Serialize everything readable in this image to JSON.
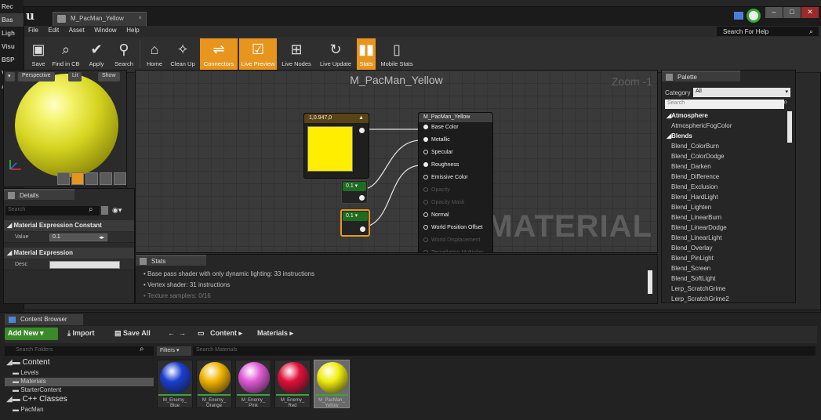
{
  "left_strip": [
    "Rec",
    "Bas",
    "Ligh",
    "Visu",
    "BSP",
    "Volu",
    "All C"
  ],
  "window": {
    "tab_title": "M_PacMan_Yellow",
    "tab_close": "×",
    "win_buttons": [
      "–",
      "□",
      "✕"
    ]
  },
  "menu": [
    "File",
    "Edit",
    "Asset",
    "Window",
    "Help"
  ],
  "search_help": {
    "placeholder": "Search For Help"
  },
  "toolbar": [
    {
      "label": "Save",
      "icon": "save-icon",
      "active": false
    },
    {
      "label": "Find in CB",
      "icon": "find-in-cb-icon",
      "active": false
    },
    {
      "label": "Apply",
      "icon": "apply-icon",
      "active": false
    },
    {
      "label": "Search",
      "icon": "search-icon",
      "active": false
    },
    {
      "label": "Home",
      "icon": "home-icon",
      "active": false
    },
    {
      "label": "Clean Up",
      "icon": "clean-up-icon",
      "active": false
    },
    {
      "label": "Connectors",
      "icon": "connectors-icon",
      "active": true
    },
    {
      "label": "Live Preview",
      "icon": "live-preview-icon",
      "active": true
    },
    {
      "label": "Live Nodes",
      "icon": "live-nodes-icon",
      "active": false
    },
    {
      "label": "Live Update",
      "icon": "live-update-icon",
      "active": false
    },
    {
      "label": "Stats",
      "icon": "stats-icon",
      "active": true
    },
    {
      "label": "Mobile Stats",
      "icon": "mobile-stats-icon",
      "active": false
    }
  ],
  "viewport": {
    "buttons": [
      "Perspective",
      "Lit",
      "Show"
    ]
  },
  "details": {
    "tab": "Details",
    "search_placeholder": "Search",
    "cat1": "Material Expression Constant",
    "value_label": "Value",
    "value": "0.1",
    "cat2": "Material Expression",
    "desc_label": "Desc"
  },
  "graph": {
    "title": "M_PacMan_Yellow",
    "zoom": "Zoom -1",
    "watermark": "MATERIAL",
    "color_node_header": "1,0.947,0",
    "const1": "0.1",
    "const2": "0.1",
    "result_header": "M_PacMan_Yellow",
    "inputs": [
      {
        "label": "Base Color",
        "filled": true,
        "dim": false
      },
      {
        "label": "Metallic",
        "filled": true,
        "dim": false
      },
      {
        "label": "Specular",
        "filled": false,
        "dim": false
      },
      {
        "label": "Roughness",
        "filled": true,
        "dim": false
      },
      {
        "label": "Emissive Color",
        "filled": false,
        "dim": false
      },
      {
        "label": "Opacity",
        "filled": false,
        "dim": true
      },
      {
        "label": "Opacity Mask",
        "filled": false,
        "dim": true
      },
      {
        "label": "Normal",
        "filled": false,
        "dim": false
      },
      {
        "label": "World Position Offset",
        "filled": false,
        "dim": false
      },
      {
        "label": "World Displacement",
        "filled": false,
        "dim": true
      },
      {
        "label": "Tessellation Multiplier",
        "filled": false,
        "dim": true
      }
    ]
  },
  "stats": {
    "tab": "Stats",
    "lines": [
      "Base pass shader with only dynamic lighting: 33 instructions",
      "Vertex shader: 31 instructions",
      "Texture samplers: 0/16"
    ]
  },
  "palette": {
    "tab": "Palette",
    "category_label": "Category",
    "category_value": "All",
    "search_placeholder": "Search",
    "items": [
      {
        "t": "Atmosphere",
        "grp": true
      },
      {
        "t": "AtmosphericFogColor",
        "grp": false
      },
      {
        "t": "Blends",
        "grp": true
      },
      {
        "t": "Blend_ColorBurn",
        "grp": false
      },
      {
        "t": "Blend_ColorDodge",
        "grp": false
      },
      {
        "t": "Blend_Darken",
        "grp": false
      },
      {
        "t": "Blend_Difference",
        "grp": false
      },
      {
        "t": "Blend_Exclusion",
        "grp": false
      },
      {
        "t": "Blend_HardLight",
        "grp": false
      },
      {
        "t": "Blend_Lighten",
        "grp": false
      },
      {
        "t": "Blend_LinearBurn",
        "grp": false
      },
      {
        "t": "Blend_LinearDodge",
        "grp": false
      },
      {
        "t": "Blend_LinearLight",
        "grp": false
      },
      {
        "t": "Blend_Overlay",
        "grp": false
      },
      {
        "t": "Blend_PinLight",
        "grp": false
      },
      {
        "t": "Blend_Screen",
        "grp": false
      },
      {
        "t": "Blend_SoftLight",
        "grp": false
      },
      {
        "t": "Lerp_ScratchGrime",
        "grp": false
      },
      {
        "t": "Lerp_ScratchGrime2",
        "grp": false
      }
    ]
  },
  "content_browser": {
    "tab": "Content Browser",
    "add_new": "Add New ▾",
    "import": "Import",
    "save_all": "Save All",
    "path": [
      "Content",
      "Materials"
    ],
    "search_folders": "Search Folders",
    "filters": "Filters ▾",
    "search_materials": "Search Materials",
    "tree": [
      {
        "label": "Content",
        "big": true,
        "indent": 0,
        "sel": false
      },
      {
        "label": "Levels",
        "big": false,
        "indent": 1,
        "sel": false
      },
      {
        "label": "Materials",
        "big": false,
        "indent": 1,
        "sel": true
      },
      {
        "label": "StarterContent",
        "big": false,
        "indent": 1,
        "sel": false
      },
      {
        "label": "C++ Classes",
        "big": true,
        "indent": 0,
        "sel": false
      },
      {
        "label": "PacMan",
        "big": false,
        "indent": 1,
        "sel": false
      }
    ],
    "assets": [
      {
        "line1": "M_Enemy_",
        "line2": "Blue",
        "color": "#1a3fd0",
        "sel": false
      },
      {
        "line1": "M_Enemy_",
        "line2": "Orange",
        "color": "#f2b400",
        "sel": false
      },
      {
        "line1": "M_Enemy_",
        "line2": "Pink",
        "color": "#e05ad6",
        "sel": false
      },
      {
        "line1": "M_Enemy_",
        "line2": "Red",
        "color": "#e0103a",
        "sel": false
      },
      {
        "line1": "M_PacMan_",
        "line2": "Yellow",
        "color": "#f0ee10",
        "sel": true
      }
    ]
  },
  "colors": {
    "accent": "#e8951e",
    "node_color": "#ffee00",
    "const_header": "#1f6d22"
  }
}
